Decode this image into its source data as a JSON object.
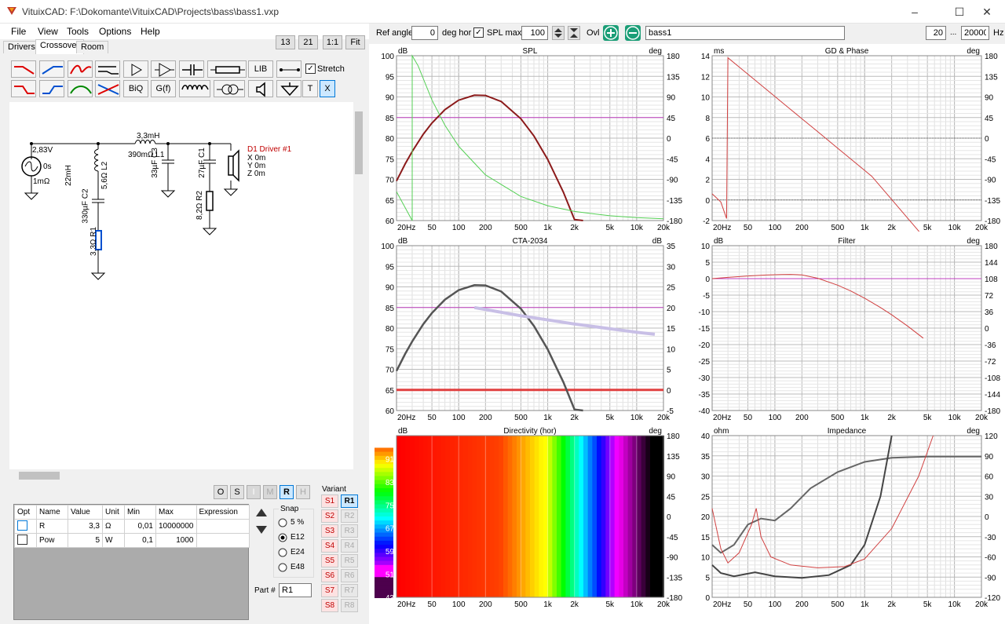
{
  "window": {
    "title": "VituixCAD: F:\\Dokomante\\VituixCAD\\Projects\\bass\\bass1.vxp"
  },
  "menu": [
    "File",
    "View",
    "Tools",
    "Options",
    "Help"
  ],
  "tabs": [
    "Drivers",
    "Crossover",
    "Room"
  ],
  "zoom_buttons": [
    "13",
    "21",
    "1:1",
    "Fit"
  ],
  "toolbar": {
    "lib": "LIB",
    "stretch": "Stretch",
    "biq": "BiQ",
    "gf": "G(f)",
    "t": "T",
    "x": "X"
  },
  "schematic": {
    "source_voltage": "2,83V",
    "source_delay": "0s",
    "source_res": "1mΩ",
    "l1_value": "3,3mH",
    "l1_res": "390mΩ L1",
    "l2_value": "22mH",
    "l2_res": "5,6Ω L2",
    "c3": "33µF C3",
    "c1": "27µF C1",
    "c2": "330µF C2",
    "r1": "3,3Ω R1",
    "r2": "8,2Ω R2",
    "driver_name": "D1 Driver #1",
    "driver_x": "X 0m",
    "driver_y": "Y 0m",
    "driver_z": "Z 0m"
  },
  "osimr": [
    "O",
    "S",
    "I",
    "M",
    "R",
    "H"
  ],
  "part_table": {
    "headers": [
      "Opt",
      "Name",
      "Value",
      "Unit",
      "Min",
      "Max",
      "Expression"
    ],
    "rows": [
      {
        "name": "R",
        "value": "3,3",
        "unit": "Ω",
        "min": "0,01",
        "max": "10000000"
      },
      {
        "name": "Pow",
        "value": "5",
        "unit": "W",
        "min": "0,1",
        "max": "1000"
      }
    ]
  },
  "snap": {
    "title": "Snap",
    "options": [
      "5 %",
      "E12",
      "E24",
      "E48"
    ],
    "selected": "E12"
  },
  "part_label": "Part #",
  "part_value": "R1",
  "variant": {
    "title": "Variant",
    "s": [
      "S1",
      "S2",
      "S3",
      "S4",
      "S5",
      "S6",
      "S7",
      "S8"
    ],
    "r": [
      "R1",
      "R2",
      "R3",
      "R4",
      "R5",
      "R6",
      "R7",
      "R8"
    ]
  },
  "header": {
    "ref_angle_label": "Ref angle",
    "ref_angle_value": "0",
    "deg_hor": "deg hor",
    "spl_max_label": "SPL max",
    "spl_max_value": "100",
    "ovl_label": "Ovl",
    "overlay_name": "bass1",
    "freq_min": "20",
    "dots": "...",
    "freq_max": "20000",
    "hz": "Hz"
  },
  "x_ticks": [
    "20Hz",
    "50",
    "100",
    "200",
    "500",
    "1k",
    "2k",
    "5k",
    "10k",
    "20k"
  ],
  "charts": {
    "spl": {
      "title": "SPL",
      "left_unit": "dB",
      "right_unit": "deg",
      "left_ticks": [
        "100",
        "95",
        "90",
        "85",
        "80",
        "75",
        "70",
        "65",
        "60"
      ],
      "right_ticks": [
        "180",
        "135",
        "90",
        "45",
        "0",
        "-45",
        "-90",
        "-135",
        "-180"
      ]
    },
    "gd": {
      "title": "GD & Phase",
      "left_unit": "ms",
      "right_unit": "deg",
      "left_ticks": [
        "14",
        "12",
        "10",
        "8",
        "6",
        "4",
        "2",
        "0",
        "-2"
      ],
      "right_ticks": [
        "180",
        "135",
        "90",
        "45",
        "0",
        "-45",
        "-90",
        "-135",
        "-180"
      ]
    },
    "cta": {
      "title": "CTA-2034",
      "left_unit": "dB",
      "right_unit": "dB",
      "left_ticks": [
        "100",
        "95",
        "90",
        "85",
        "80",
        "75",
        "70",
        "65",
        "60"
      ],
      "right_ticks": [
        "35",
        "30",
        "25",
        "20",
        "15",
        "10",
        "5",
        "0",
        "-5"
      ]
    },
    "filter": {
      "title": "Filter",
      "left_unit": "dB",
      "right_unit": "deg",
      "left_ticks": [
        "10",
        "5",
        "0",
        "-5",
        "-10",
        "-15",
        "-20",
        "-25",
        "-30",
        "-35",
        "-40"
      ],
      "right_ticks": [
        "180",
        "144",
        "108",
        "72",
        "36",
        "0",
        "-36",
        "-72",
        "-108",
        "-144",
        "-180"
      ]
    },
    "directivity": {
      "title": "Directivity (hor)",
      "left_unit": "dB",
      "right_unit": "deg",
      "left_ticks": [
        "99",
        "91",
        "83",
        "75",
        "67",
        "59",
        "51",
        "43"
      ],
      "right_ticks": [
        "180",
        "135",
        "90",
        "45",
        "0",
        "-45",
        "-90",
        "-135",
        "-180"
      ]
    },
    "impedance": {
      "title": "Impedance",
      "left_unit": "ohm",
      "right_unit": "deg",
      "left_ticks": [
        "40",
        "35",
        "30",
        "25",
        "20",
        "15",
        "10",
        "5",
        "0"
      ],
      "right_ticks": [
        "120",
        "90",
        "60",
        "30",
        "0",
        "-30",
        "-60",
        "-90",
        "-120"
      ]
    }
  }
}
